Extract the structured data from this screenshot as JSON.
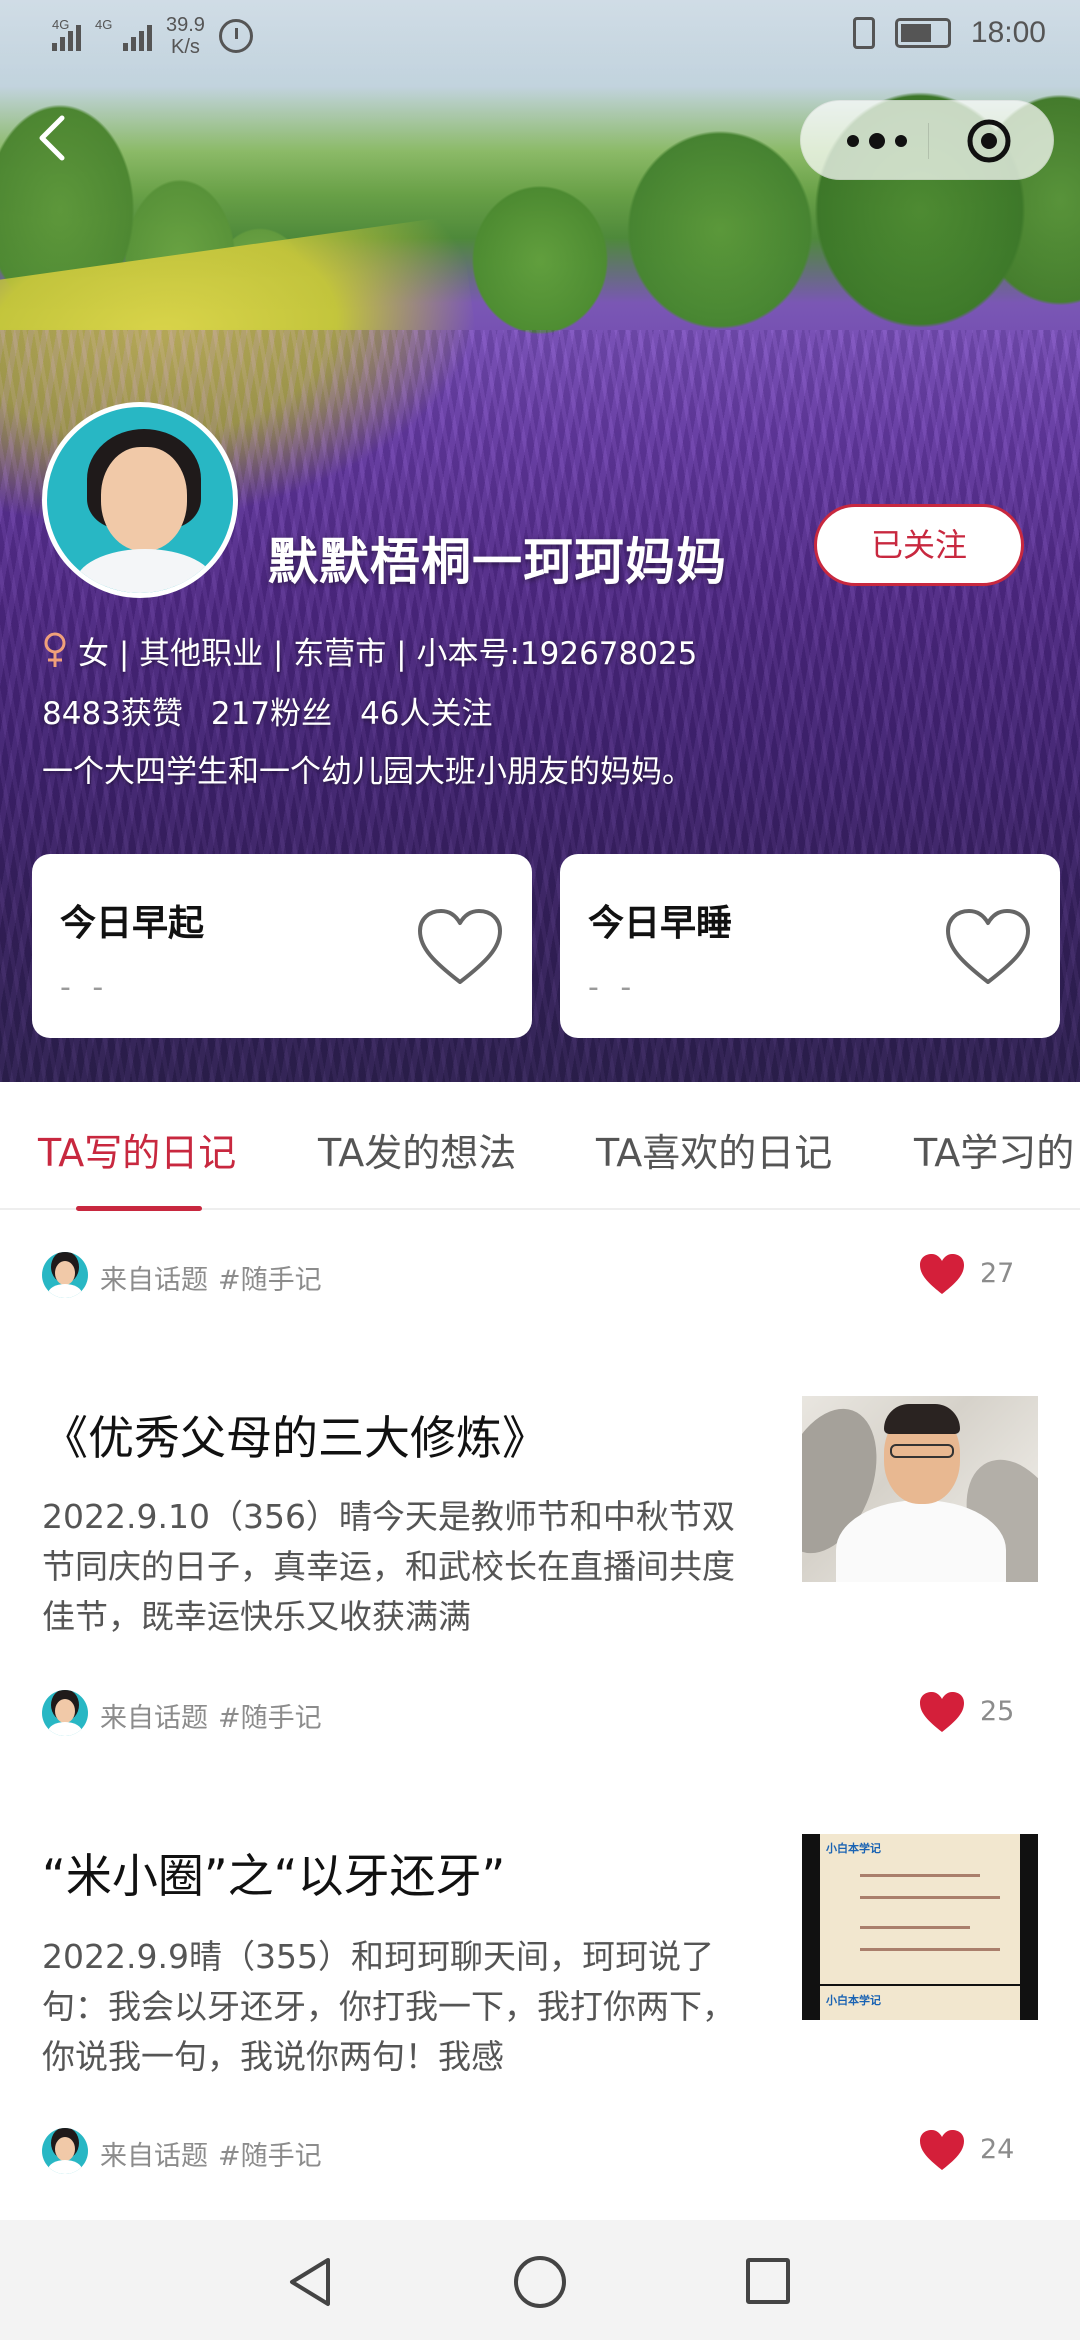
{
  "status_bar": {
    "network_1": "4G",
    "network_2": "4G",
    "speed_value": "39.9",
    "speed_unit": "K/s",
    "time": "18:00"
  },
  "profile": {
    "nickname": "默默梧桐一珂珂妈妈",
    "follow_label": "已关注",
    "meta": "女 | 其他职业 | 东营市 | 小本号:192678025",
    "likes": "8483获赞",
    "fans": "217粉丝",
    "following": "46人关注",
    "bio": "一个大四学生和一个幼儿园大班小朋友的妈妈。"
  },
  "cards": [
    {
      "title": "今日早起",
      "value": "- -"
    },
    {
      "title": "今日早睡",
      "value": "- -"
    }
  ],
  "tabs": [
    {
      "label": "TA写的日记",
      "active": true
    },
    {
      "label": "TA发的想法"
    },
    {
      "label": "TA喜欢的日记"
    },
    {
      "label": "TA学习的"
    }
  ],
  "posts": [
    {
      "from": "来自话题",
      "tag": "#随手记",
      "likes": "27"
    },
    {
      "title": "《优秀父母的三大修炼》",
      "excerpt": "2022.9.10（356）晴今天是教师节和中秋节双节同庆的日子，真幸运，和武校长在直播间共度佳节，既幸运快乐又收获满满",
      "from": "来自话题",
      "tag": "#随手记",
      "likes": "25",
      "thumb": "man-on-video"
    },
    {
      "title": "“米小圈”之“以牙还牙”",
      "excerpt": "2022.9.9晴（355）和珂珂聊天间，珂珂说了句：我会以牙还牙，你打我一下，我打你两下，你说我一句，我说你两句！我感",
      "from": "来自话题",
      "tag": "#随手记",
      "likes": "24",
      "thumb": "slide-card",
      "thumb_label": "小白本学记"
    }
  ],
  "colors": {
    "accent": "#c8283f",
    "avatar_bg": "#28b7c4"
  },
  "icons": [
    "back-icon",
    "more-icon",
    "target-icon",
    "female-icon",
    "heart-outline-icon",
    "heart-icon",
    "nav-back-icon",
    "nav-home-icon",
    "nav-recent-icon",
    "alarm-icon",
    "vibrate-icon",
    "battery-icon"
  ]
}
